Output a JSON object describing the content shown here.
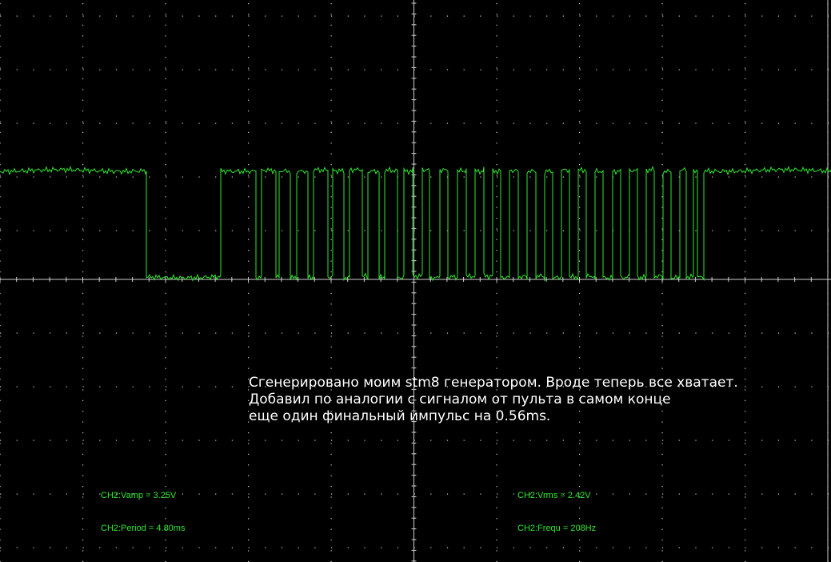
{
  "colors": {
    "background": "#000000",
    "trace": "#2ee82e",
    "grid": "#cfcfcf",
    "annotation_text": "#ffffff"
  },
  "annotation": {
    "lines": [
      "Сгенерировано моим stm8 генератором. Вроде теперь все хватает.",
      "Добавил по аналогии с сигналом от пульта в самом конце",
      "еще один финальный импульс на 0.56ms."
    ]
  },
  "measurements": {
    "vamp": "CH2:Vamp = 3.25V",
    "vrms": "CH2:Vrms = 2.42V",
    "period": "CH2:Period = 4.80ms",
    "frequ": "CH2:Frequ = 208Hz"
  },
  "chart_data": {
    "type": "line",
    "title": "",
    "xlabel": "",
    "ylabel": "",
    "grid": true,
    "series": [
      {
        "name": "",
        "description_levels": "1 = high, 0 = low",
        "segments": [
          [
            0,
            1
          ],
          [
            183,
            0
          ],
          [
            276,
            1
          ],
          [
            320,
            0
          ],
          [
            327,
            1
          ],
          [
            345,
            0
          ],
          [
            349,
            1
          ],
          [
            363,
            0
          ],
          [
            371,
            1
          ],
          [
            385,
            0
          ],
          [
            392,
            1
          ],
          [
            410,
            0
          ],
          [
            416,
            1
          ],
          [
            430,
            0
          ],
          [
            437,
            1
          ],
          [
            453,
            0
          ],
          [
            460,
            1
          ],
          [
            474,
            0
          ],
          [
            481,
            1
          ],
          [
            497,
            0
          ],
          [
            505,
            1
          ],
          [
            516,
            0
          ],
          [
            528,
            1
          ],
          [
            537,
            0
          ],
          [
            550,
            1
          ],
          [
            560,
            0
          ],
          [
            572,
            1
          ],
          [
            583,
            0
          ],
          [
            594,
            1
          ],
          [
            605,
            0
          ],
          [
            616,
            1
          ],
          [
            626,
            0
          ],
          [
            637,
            1
          ],
          [
            648,
            0
          ],
          [
            659,
            1
          ],
          [
            670,
            0
          ],
          [
            681,
            1
          ],
          [
            691,
            0
          ],
          [
            702,
            1
          ],
          [
            712,
            0
          ],
          [
            723,
            1
          ],
          [
            733,
            0
          ],
          [
            744,
            1
          ],
          [
            754,
            0
          ],
          [
            766,
            1
          ],
          [
            776,
            0
          ],
          [
            787,
            1
          ],
          [
            797,
            0
          ],
          [
            808,
            1
          ],
          [
            818,
            0
          ],
          [
            829,
            1
          ],
          [
            839,
            0
          ],
          [
            850,
            1
          ],
          [
            858,
            0
          ],
          [
            867,
            1
          ],
          [
            872,
            0
          ],
          [
            880,
            1
          ],
          [
            1039,
            1
          ]
        ]
      }
    ]
  }
}
